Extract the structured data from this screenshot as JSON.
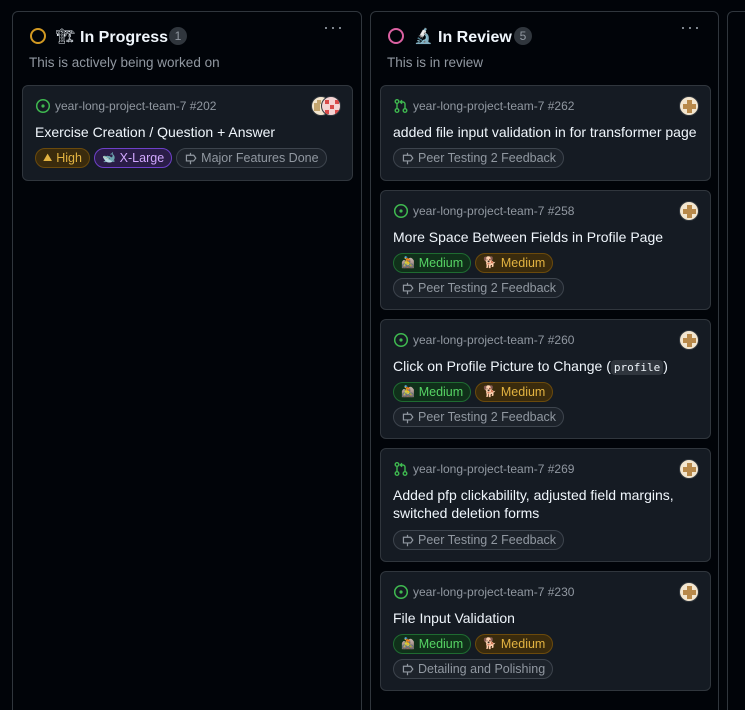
{
  "columns": [
    {
      "title": "In Progress",
      "emoji": "🏗",
      "count": "1",
      "description": "This is actively being worked on",
      "status_color": "#d29922",
      "cards": [
        {
          "kind": "issue",
          "repo": "year-long-project-team-7 #202",
          "title": "Exercise Creation / Question + Answer",
          "labels": [
            {
              "emoji": "⛰",
              "text": "High",
              "style": "high"
            },
            {
              "emoji": "🐋",
              "text": "X-Large",
              "style": "xlarge"
            }
          ],
          "milestone": "Major Features Done"
        }
      ]
    },
    {
      "title": "In Review",
      "emoji": "🔬",
      "count": "5",
      "description": "This is in review",
      "status_color": "#db61a2",
      "cards": [
        {
          "kind": "pull-request",
          "repo": "year-long-project-team-7 #262",
          "title": "added file input validation in for transformer page",
          "labels": [],
          "milestone": "Peer Testing 2 Feedback"
        },
        {
          "kind": "issue",
          "repo": "year-long-project-team-7 #258",
          "title": "More Space Between Fields in Profile Page",
          "labels": [
            {
              "emoji": "🚵",
              "text": "Medium",
              "style": "medium-g"
            },
            {
              "emoji": "🐕",
              "text": "Medium",
              "style": "medium-o"
            }
          ],
          "milestone": "Peer Testing 2 Feedback"
        },
        {
          "kind": "issue",
          "repo": "year-long-project-team-7 #260",
          "title_prefix": "Click on Profile Picture to Change (",
          "title_code": "profile",
          "title_suffix": ")",
          "labels": [
            {
              "emoji": "🚵",
              "text": "Medium",
              "style": "medium-g"
            },
            {
              "emoji": "🐕",
              "text": "Medium",
              "style": "medium-o"
            }
          ],
          "milestone": "Peer Testing 2 Feedback"
        },
        {
          "kind": "pull-request",
          "repo": "year-long-project-team-7 #269",
          "title_line1": "Added pfp clickabililty, adjusted field margins,",
          "title_line2": "switched deletion forms",
          "labels": [],
          "milestone": "Peer Testing 2 Feedback"
        },
        {
          "kind": "issue",
          "repo": "year-long-project-team-7 #230",
          "title": "File Input Validation",
          "labels": [
            {
              "emoji": "🚵",
              "text": "Medium",
              "style": "medium-g"
            },
            {
              "emoji": "🐕",
              "text": "Medium",
              "style": "medium-o"
            }
          ],
          "milestone": "Detailing and Polishing"
        }
      ]
    }
  ],
  "menu_glyph": "···",
  "icons": {
    "issue_open": "issue-opened-icon",
    "pull_request": "git-pull-request-icon",
    "milestone": "milestone-icon",
    "more": "kebab-menu-icon"
  },
  "colors": {
    "issue_green": "#3fb950",
    "pr_green": "#3fb950"
  }
}
